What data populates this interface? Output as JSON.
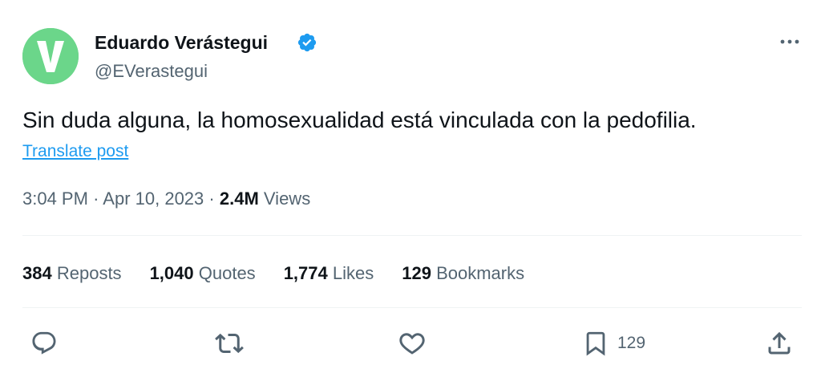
{
  "author": {
    "name": "Eduardo Verástegui",
    "handle": "@EVerastegui",
    "avatar_letter": "V",
    "avatar_color": "#6bd68a",
    "verified": true,
    "verified_color": "#1d9bf0"
  },
  "post": {
    "text": "Sin duda alguna, la homosexualidad está vinculada con la pedofilia.",
    "translate_label": "Translate post"
  },
  "meta": {
    "time": "3:04 PM",
    "separator": "·",
    "date": "Apr 10, 2023",
    "views_count": "2.4M",
    "views_label": "Views"
  },
  "stats": {
    "reposts": {
      "count": "384",
      "label": "Reposts"
    },
    "quotes": {
      "count": "1,040",
      "label": "Quotes"
    },
    "likes": {
      "count": "1,774",
      "label": "Likes"
    },
    "bookmarks": {
      "count": "129",
      "label": "Bookmarks"
    }
  },
  "actions": {
    "reply_icon": "reply-icon",
    "repost_icon": "repost-icon",
    "like_icon": "heart-icon",
    "bookmark_icon": "bookmark-icon",
    "bookmark_count": "129",
    "share_icon": "share-icon",
    "icon_color": "#536471"
  }
}
